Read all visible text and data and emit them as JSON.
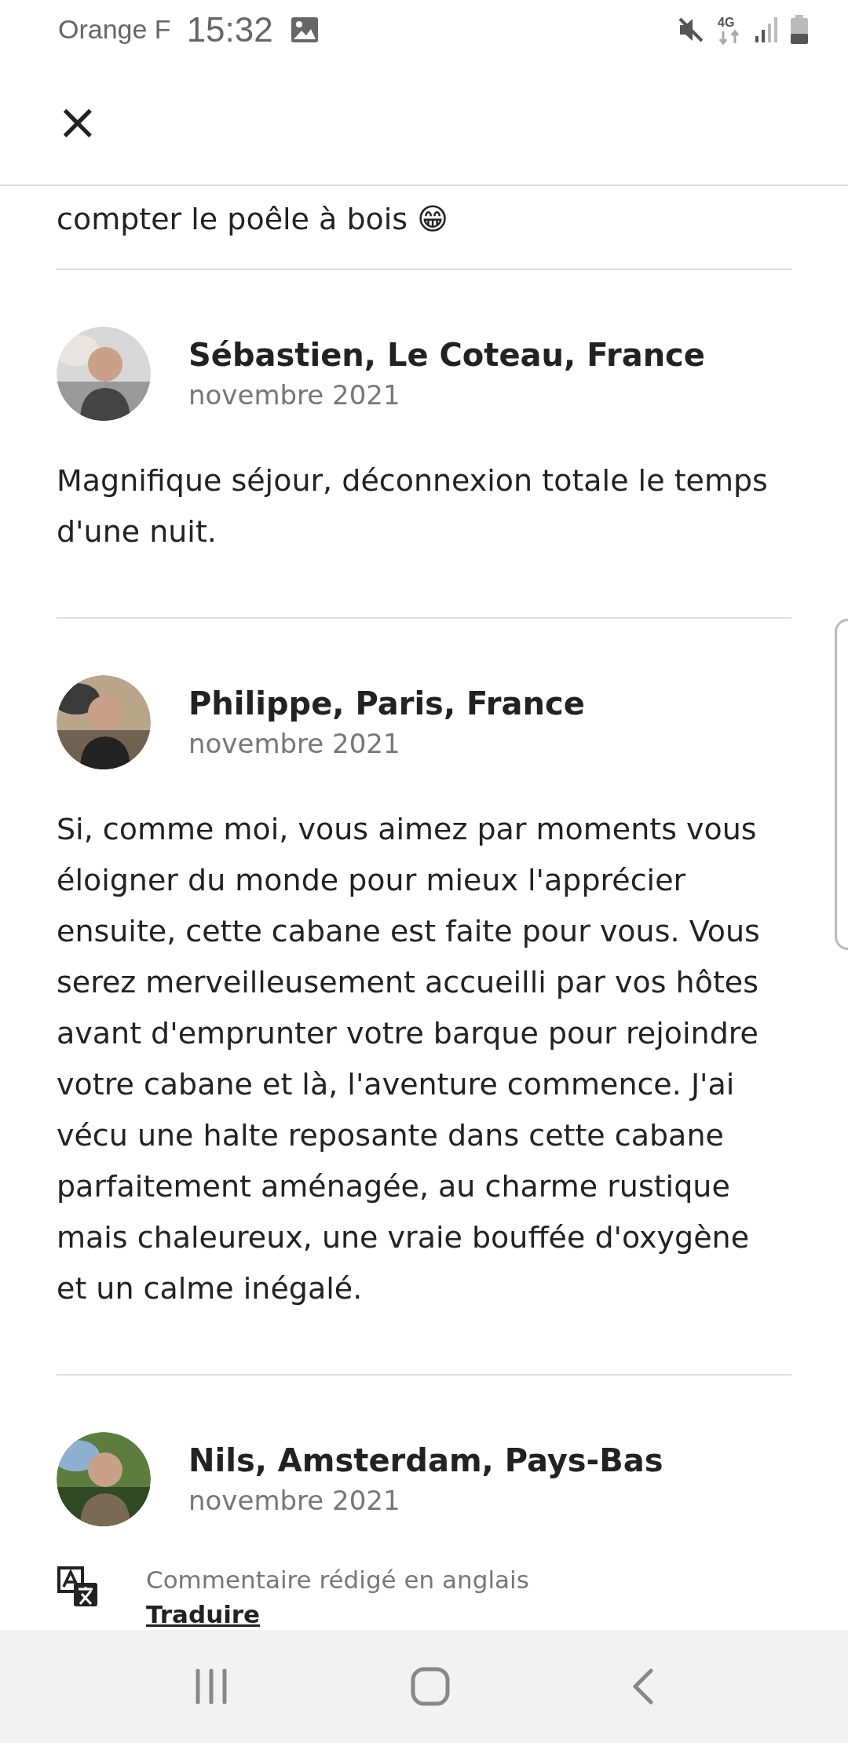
{
  "status_bar": {
    "carrier": "Orange F",
    "time": "15:32",
    "network": "4G"
  },
  "header": {
    "close": "×"
  },
  "previous_review_tail": "compter le poêle à bois 😁",
  "reviews": [
    {
      "author": "Sébastien, Le Coteau, France",
      "date": "novembre 2021",
      "text": "Magnifique séjour, déconnexion totale le temps d'une nuit."
    },
    {
      "author": "Philippe, Paris, France",
      "date": "novembre 2021",
      "text": "Si, comme moi, vous aimez par moments vous éloigner du monde pour mieux l'apprécier ensuite, cette cabane est faite pour vous. Vous serez merveilleusement accueilli par vos hôtes avant d'emprunter votre barque pour rejoindre votre cabane et là, l'aventure commence. J'ai vécu une halte reposante dans cette cabane parfaitement aménagée, au charme rustique mais chaleureux, une vraie bouffée d'oxygène et un calme inégalé."
    },
    {
      "author": "Nils, Amsterdam, Pays-Bas",
      "date": "novembre 2021",
      "translation": {
        "note": "Commentaire rédigé en anglais",
        "link": "Traduire"
      }
    }
  ]
}
